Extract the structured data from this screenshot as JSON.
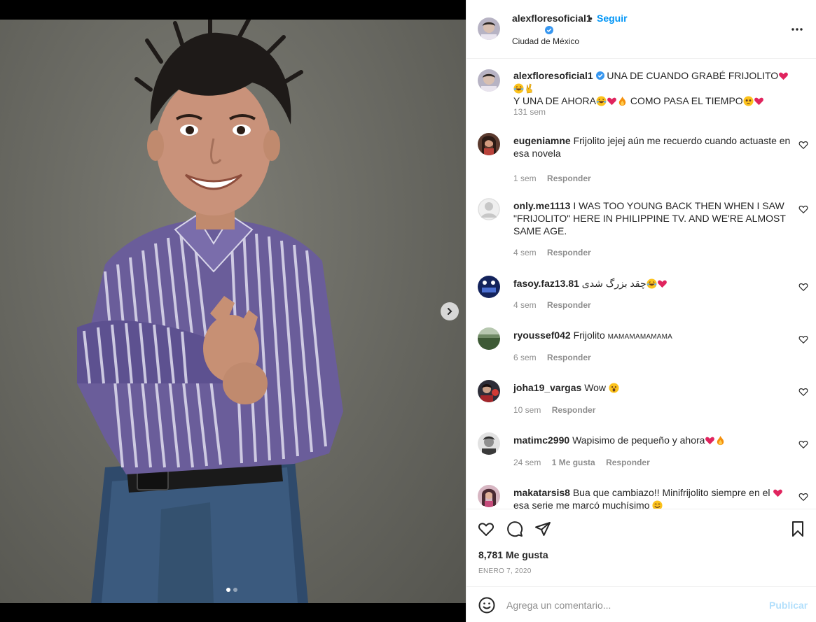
{
  "post": {
    "username": "alexfloresoficial1",
    "separator": "•",
    "follow_label": "Seguir",
    "location": "Ciudad de México",
    "more_icon": "more-horizontal-icon"
  },
  "caption": {
    "username": "alexfloresoficial1",
    "line1": "UNA DE CUANDO GRABÉ FRIJOLITO",
    "line2a": "Y UNA DE AHORA",
    "line2b": "COMO PASA EL TIEMPO",
    "time": "131 sem"
  },
  "comments": [
    {
      "username": "eugeniamne",
      "text": "Frijolito jejej aún me recuerdo cuando actuaste en esa novela",
      "time": "1 sem",
      "reply": "Responder"
    },
    {
      "username": "only.me1113",
      "text": "I WAS TOO YOUNG BACK THEN WHEN I SAW \"FRIJOLITO\" HERE IN PHILIPPINE TV. AND WE'RE ALMOST SAME AGE.",
      "time": "4 sem",
      "reply": "Responder"
    },
    {
      "username": "fasoy.faz13.81",
      "text": "چقد بزرگ شدی",
      "time": "4 sem",
      "reply": "Responder"
    },
    {
      "username": "ryoussef042",
      "text": "Frijolito",
      "text_small": "MAMAMAMAMAMA",
      "time": "6 sem",
      "reply": "Responder"
    },
    {
      "username": "joha19_vargas",
      "text": "Wow",
      "time": "10 sem",
      "reply": "Responder"
    },
    {
      "username": "matimc2990",
      "text": "Wapisimo de pequeño y ahora",
      "time": "24 sem",
      "likes": "1 Me gusta",
      "reply": "Responder"
    },
    {
      "username": "makatarsis8",
      "text": "Bua que cambiazo!! Minifrijolito siempre en el",
      "text2": "esa serie me marcó muchísimo",
      "time": "",
      "reply": ""
    }
  ],
  "actions": {
    "likes": "8,781 Me gusta",
    "date": "ENERO 7, 2020"
  },
  "composer": {
    "placeholder": "Agrega un comentario...",
    "post_label": "Publicar"
  },
  "colors": {
    "accent": "#0095f6",
    "verified": "#3897f0",
    "heart_red": "#e0245e",
    "muted": "#8e8e8e"
  }
}
